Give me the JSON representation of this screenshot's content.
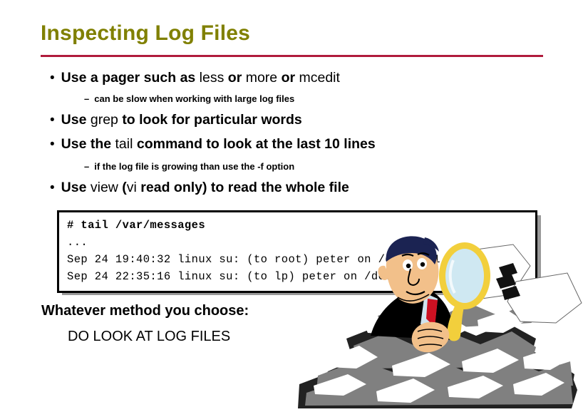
{
  "slide": {
    "title": "Inspecting Log Files",
    "accent_rule_color": "#b01b3c",
    "title_color": "#808000",
    "background_color": "#ffffff"
  },
  "bullets": [
    {
      "marker": "•",
      "segments": [
        {
          "text": "Use a pager such ",
          "bold": true
        },
        {
          "text": "as ",
          "bold": true
        },
        {
          "text": "less ",
          "bold": false
        },
        {
          "text": "or ",
          "bold": true
        },
        {
          "text": "more ",
          "bold": false
        },
        {
          "text": "or ",
          "bold": true
        },
        {
          "text": "mcedit",
          "bold": false
        }
      ],
      "plain": "Use a pager such as less or more or mcedit"
    },
    {
      "marker": "•",
      "segments": [
        {
          "text": "Use ",
          "bold": true
        },
        {
          "text": "grep ",
          "bold": false
        },
        {
          "text": "to look for particular words",
          "bold": true
        }
      ],
      "plain": "Use grep to look for particular words"
    },
    {
      "marker": "•",
      "segments": [
        {
          "text": "Use the ",
          "bold": true
        },
        {
          "text": "tail ",
          "bold": false
        },
        {
          "text": "command to look at the last 10 lines",
          "bold": true
        }
      ],
      "plain": "Use the tail command to look at the last 10 lines"
    },
    {
      "marker": "•",
      "segments": [
        {
          "text": "Use ",
          "bold": true
        },
        {
          "text": "view ",
          "bold": false
        },
        {
          "text": "(",
          "bold": true
        },
        {
          "text": "vi ",
          "bold": false
        },
        {
          "text": "read only) to read the whole file",
          "bold": true
        }
      ],
      "plain": "Use view (vi read only) to read the whole file"
    }
  ],
  "sub_bullets": [
    {
      "marker": "–",
      "text": "can be slow when working with large log files"
    },
    {
      "marker": "–",
      "text": "if the log file is growing than use the -f option"
    }
  ],
  "code_box": {
    "lines": [
      "# tail /var/messages",
      "...",
      "Sep 24 19:40:32 linux su: (to root) peter on /dev/tty1",
      "Sep 24 22:35:16 linux su: (to lp) peter on /dev/tty2"
    ],
    "border_color": "#000000",
    "shadow_color": "#999999",
    "background_color": "#ffffff"
  },
  "closing": {
    "line1": "Whatever method you choose:",
    "line2": "DO LOOK AT LOG FILES"
  },
  "clipart": {
    "name": "man-with-magnifying-glass-in-paper-pile",
    "colors": {
      "suit": "#000000",
      "hair": "#1b2352",
      "skin": "#f2c08a",
      "shirt": "#cfe4ef",
      "tie": "#cc1122",
      "glass_rim": "#f2cf3c",
      "lens": "#cfe8f2",
      "paper_white": "#ffffff",
      "paper_gray": "#808080",
      "paper_dark": "#222222"
    }
  }
}
